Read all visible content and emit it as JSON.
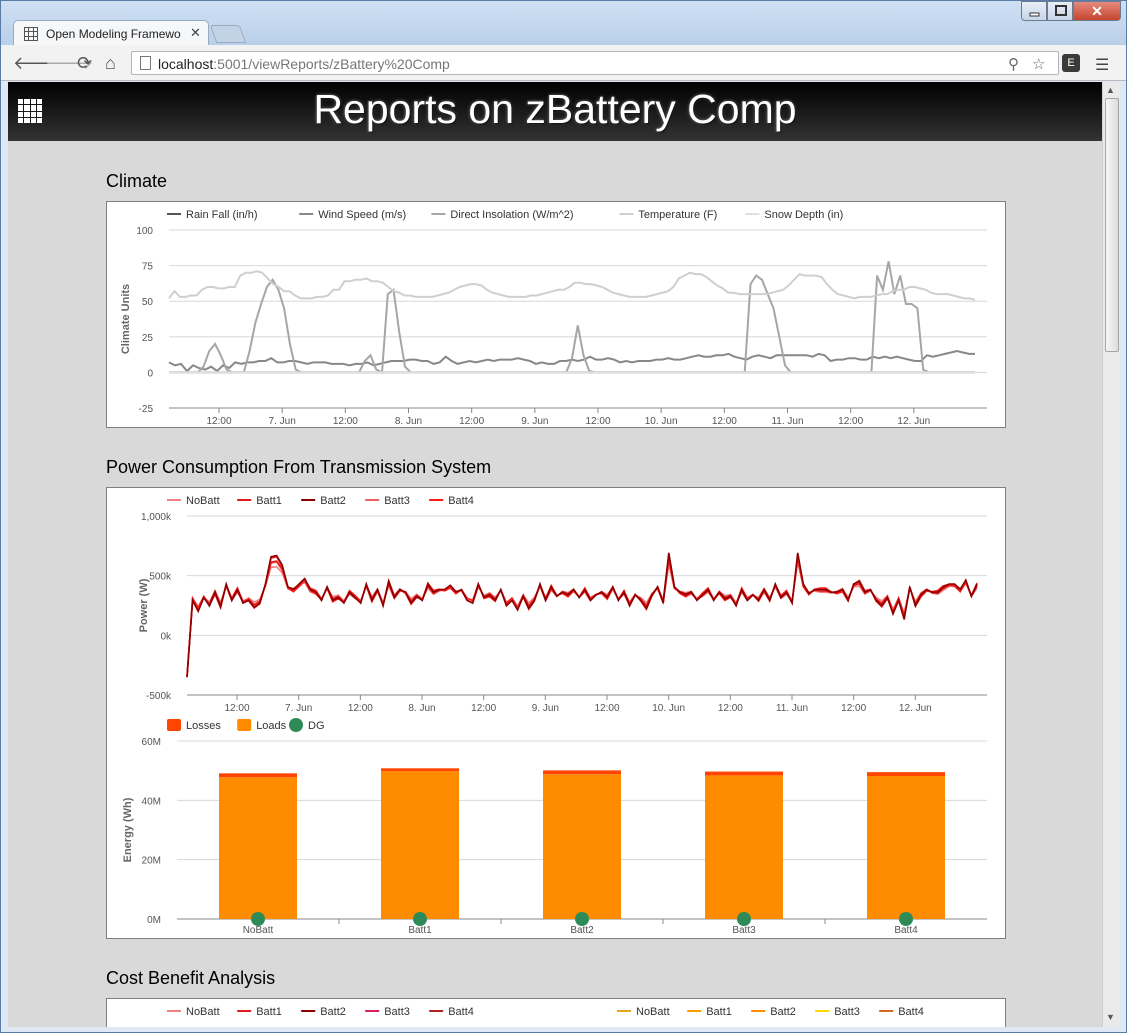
{
  "browser": {
    "tab_title": "Open Modeling Framework",
    "url_host": "localhost",
    "url_rest": ":5001/viewReports/zBattery%20Comp"
  },
  "page": {
    "title": "Reports on zBattery Comp"
  },
  "sections": {
    "climate": "Climate",
    "power": "Power Consumption From Transmission System",
    "cost": "Cost Benefit Analysis"
  },
  "colors": {
    "accent_orange": "#ff8c00",
    "loss_red": "#ff4500",
    "dg_green": "#2e8b57"
  },
  "chart_data": [
    {
      "id": "climate",
      "type": "line",
      "ylabel": "Climate Units",
      "ylim": [
        -25,
        100
      ],
      "yticks": [
        -25,
        0,
        25,
        50,
        75,
        100
      ],
      "xticks": [
        "12:00",
        "7. Jun",
        "12:00",
        "8. Jun",
        "12:00",
        "9. Jun",
        "12:00",
        "10. Jun",
        "12:00",
        "11. Jun",
        "12:00",
        "12. Jun"
      ],
      "grid": true,
      "legend": "top-left",
      "series": [
        {
          "name": "Rain Fall (in/h)",
          "color": "#555555",
          "values": [
            0,
            0,
            0,
            0,
            0,
            0,
            0,
            0,
            0,
            0,
            0,
            0,
            0,
            0,
            0,
            0,
            0,
            0,
            0,
            0,
            0,
            0,
            0,
            0,
            0,
            0,
            0,
            0,
            0,
            0,
            0,
            0,
            0,
            0,
            0,
            0,
            0,
            0,
            0,
            0,
            0,
            0,
            0,
            0,
            0,
            0,
            0,
            0,
            0,
            0,
            0,
            0,
            0,
            0,
            0,
            0,
            0,
            0,
            0,
            0,
            0,
            0,
            0,
            0,
            0,
            0,
            0,
            0,
            0,
            0,
            0,
            0,
            0,
            0,
            0,
            0,
            0,
            0,
            0,
            0,
            0,
            0,
            0,
            0,
            0,
            0,
            0,
            0,
            0,
            0,
            0,
            0,
            0,
            0,
            0,
            0,
            0,
            0,
            0,
            0,
            0,
            0,
            0,
            0,
            0,
            0,
            0,
            0,
            0,
            0,
            0,
            0,
            0,
            0,
            0,
            0,
            0,
            0,
            0,
            0,
            0,
            0,
            0,
            0,
            0
          ]
        },
        {
          "name": "Wind Speed (m/s)",
          "color": "#888888",
          "values": [
            7,
            5,
            6,
            1,
            5,
            3,
            2,
            4,
            1,
            5,
            3,
            7,
            6,
            7,
            7,
            8,
            8,
            10,
            7,
            7,
            8,
            8,
            7,
            6,
            7,
            7,
            7,
            6,
            6,
            6,
            5,
            6,
            6,
            7,
            5,
            6,
            7,
            8,
            8,
            8,
            9,
            9,
            8,
            8,
            6,
            7,
            11,
            8,
            6,
            7,
            8,
            7,
            8,
            9,
            8,
            9,
            9,
            9,
            10,
            9,
            8,
            6,
            7,
            6,
            6,
            8,
            8,
            9,
            8,
            9,
            11,
            9,
            9,
            10,
            9,
            7,
            8,
            7,
            8,
            8,
            8,
            9,
            9,
            10,
            9,
            9,
            10,
            11,
            12,
            11,
            11,
            12,
            12,
            13,
            11,
            10,
            9,
            11,
            12,
            11,
            10,
            12,
            12,
            12,
            12,
            12,
            12,
            11,
            13,
            12,
            8,
            9,
            9,
            10,
            10,
            9,
            9,
            11,
            10,
            11,
            10,
            11,
            10,
            9,
            8,
            8,
            12,
            11,
            12,
            13,
            14,
            15,
            14,
            13,
            13
          ]
        },
        {
          "name": "Direct Insolation (W/m^2)",
          "color": "#a6a6a6",
          "values": [
            0,
            0,
            0,
            0,
            0,
            0,
            4,
            15,
            20,
            12,
            2,
            0,
            0,
            0,
            15,
            35,
            48,
            60,
            65,
            58,
            45,
            20,
            2,
            0,
            0,
            0,
            0,
            0,
            0,
            0,
            0,
            0,
            0,
            0,
            8,
            12,
            2,
            0,
            55,
            58,
            28,
            4,
            0,
            0,
            0,
            0,
            0,
            0,
            0,
            0,
            0,
            0,
            0,
            0,
            0,
            0,
            0,
            0,
            0,
            0,
            0,
            0,
            0,
            0,
            0,
            0,
            0,
            0,
            0,
            0,
            10,
            33,
            12,
            1,
            0,
            0,
            0,
            0,
            0,
            0,
            0,
            0,
            0,
            0,
            0,
            0,
            0,
            0,
            0,
            0,
            0,
            0,
            0,
            0,
            0,
            0,
            0,
            0,
            0,
            0,
            0,
            62,
            68,
            65,
            55,
            45,
            25,
            5,
            0,
            0,
            0,
            0,
            0,
            0,
            0,
            0,
            0,
            0,
            0,
            0,
            0,
            0,
            0,
            68,
            58,
            78,
            55,
            68,
            48,
            48,
            45,
            2,
            0,
            0,
            0,
            0,
            0,
            0,
            0,
            0,
            0
          ]
        },
        {
          "name": "Temperature (F)",
          "color": "#cfcfcf",
          "values": [
            52,
            57,
            53,
            53,
            54,
            54,
            58,
            60,
            60,
            59,
            59,
            60,
            60,
            68,
            70,
            70,
            71,
            70,
            66,
            62,
            60,
            57,
            57,
            54,
            52,
            52,
            52,
            53,
            53,
            54,
            58,
            58,
            64,
            64,
            65,
            65,
            66,
            64,
            64,
            63,
            60,
            57,
            56,
            54,
            54,
            53,
            53,
            53,
            53,
            54,
            55,
            56,
            58,
            60,
            61,
            62,
            62,
            61,
            58,
            56,
            55,
            54,
            53,
            53,
            53,
            53,
            54,
            54,
            55,
            56,
            57,
            58,
            58,
            60,
            63,
            63,
            62,
            62,
            61,
            60,
            58,
            56,
            55,
            54,
            53,
            53,
            53,
            53,
            54,
            55,
            56,
            57,
            60,
            66,
            68,
            70,
            69,
            69,
            67,
            64,
            61,
            59,
            56,
            56,
            55,
            55,
            55,
            55,
            55,
            55,
            56,
            57,
            58,
            61,
            65,
            69,
            68,
            68,
            68,
            67,
            62,
            58,
            55,
            54,
            53,
            52,
            53,
            53,
            53,
            54,
            55,
            55,
            57,
            58,
            58,
            60,
            60,
            59,
            58,
            56,
            55,
            55,
            55,
            54,
            53,
            52,
            52,
            51
          ]
        },
        {
          "name": "Snow Depth (in)",
          "color": "#e0e0e0",
          "values": [
            0,
            0,
            0,
            0,
            0,
            0,
            0,
            0,
            0,
            0,
            0,
            0,
            0,
            0,
            0,
            0,
            0,
            0,
            0,
            0,
            0,
            0,
            0,
            0,
            0,
            0,
            0,
            0,
            0,
            0,
            0,
            0,
            0,
            0,
            0,
            0,
            0,
            0,
            0,
            0,
            0,
            0,
            0,
            0,
            0,
            0,
            0,
            0,
            0,
            0,
            0,
            0,
            0,
            0,
            0,
            0,
            0,
            0,
            0,
            0,
            0,
            0,
            0,
            0,
            0,
            0,
            0,
            0,
            0,
            0,
            0,
            0,
            0,
            0,
            0,
            0,
            0,
            0,
            0,
            0,
            0,
            0,
            0,
            0,
            0,
            0,
            0,
            0,
            0,
            0,
            0,
            0,
            0,
            0,
            0,
            0,
            0,
            0,
            0,
            0,
            0,
            0,
            0,
            0,
            0,
            0,
            0,
            0,
            0,
            0,
            0,
            0,
            0,
            0,
            0,
            0,
            0,
            0,
            0,
            0,
            0,
            0,
            0,
            0,
            0
          ]
        }
      ]
    },
    {
      "id": "power",
      "type": "line",
      "ylabel": "Power (W)",
      "ylim": [
        -500000,
        1000000
      ],
      "ytick_labels": [
        "-500k",
        "0k",
        "500k",
        "1,000k"
      ],
      "yticks": [
        -500000,
        0,
        500000,
        1000000
      ],
      "xticks": [
        "12:00",
        "7. Jun",
        "12:00",
        "8. Jun",
        "12:00",
        "9. Jun",
        "12:00",
        "10. Jun",
        "12:00",
        "11. Jun",
        "12:00",
        "12. Jun"
      ],
      "grid": true,
      "legend": "top-left",
      "series": [
        {
          "name": "NoBatt",
          "color": "#f28080"
        },
        {
          "name": "Batt1",
          "color": "#e31a1c"
        },
        {
          "name": "Batt2",
          "color": "#8b0000"
        },
        {
          "name": "Batt3",
          "color": "#f06060"
        },
        {
          "name": "Batt4",
          "color": "#ff1a1a"
        }
      ],
      "base_values": [
        -350000,
        300000,
        220000,
        320000,
        260000,
        360000,
        250000,
        420000,
        300000,
        380000,
        280000,
        300000,
        250000,
        280000,
        420000,
        620000,
        630000,
        560000,
        400000,
        380000,
        420000,
        460000,
        380000,
        360000,
        300000,
        400000,
        300000,
        320000,
        280000,
        360000,
        320000,
        280000,
        420000,
        300000,
        380000,
        260000,
        440000,
        320000,
        380000,
        360000,
        280000,
        330000,
        300000,
        420000,
        360000,
        380000,
        380000,
        410000,
        360000,
        380000,
        300000,
        280000,
        420000,
        320000,
        340000,
        300000,
        380000,
        260000,
        300000,
        230000,
        330000,
        240000,
        300000,
        420000,
        300000,
        400000,
        330000,
        360000,
        340000,
        380000,
        320000,
        380000,
        300000,
        340000,
        360000,
        320000,
        400000,
        300000,
        360000,
        260000,
        340000,
        300000,
        240000,
        340000,
        400000,
        280000,
        650000,
        400000,
        360000,
        340000,
        360000,
        300000,
        340000,
        380000,
        300000,
        360000,
        310000,
        330000,
        260000,
        380000,
        300000,
        340000,
        300000,
        380000,
        300000,
        420000,
        320000,
        360000,
        280000,
        650000,
        420000,
        350000,
        380000,
        380000,
        380000,
        360000,
        360000,
        380000,
        300000,
        420000,
        440000,
        360000,
        380000,
        300000,
        260000,
        320000,
        200000,
        300000,
        160000,
        400000,
        260000,
        340000,
        380000,
        360000,
        360000,
        400000,
        420000,
        420000,
        380000,
        450000,
        330000,
        420000
      ]
    },
    {
      "id": "energy",
      "type": "bar",
      "ylabel": "Energy (Wh)",
      "ylim": [
        0,
        60000000
      ],
      "ytick_labels": [
        "0M",
        "20M",
        "40M",
        "60M"
      ],
      "yticks": [
        0,
        20000000,
        40000000,
        60000000
      ],
      "categories": [
        "NoBatt",
        "Batt1",
        "Batt2",
        "Batt3",
        "Batt4"
      ],
      "legend": "top-left",
      "series": [
        {
          "name": "Losses",
          "color": "#ff4500",
          "values": [
            1300000,
            1000000,
            1300000,
            1300000,
            1300000
          ]
        },
        {
          "name": "Loads",
          "color": "#ff8c00",
          "values": [
            47800000,
            49800000,
            48800000,
            48400000,
            48200000
          ]
        },
        {
          "name": "DG",
          "color": "#2e8b57",
          "values": [
            0,
            0,
            0,
            0,
            0
          ]
        }
      ]
    },
    {
      "id": "cost-left",
      "type": "line",
      "legend": "top-left",
      "series": [
        {
          "name": "NoBatt",
          "color": "#f28080"
        },
        {
          "name": "Batt1",
          "color": "#e31a1c"
        },
        {
          "name": "Batt2",
          "color": "#8b0000"
        },
        {
          "name": "Batt3",
          "color": "#d62058"
        },
        {
          "name": "Batt4",
          "color": "#b22222"
        }
      ]
    },
    {
      "id": "cost-right",
      "type": "line",
      "legend": "top-left",
      "series": [
        {
          "name": "NoBatt",
          "color": "#e6a817"
        },
        {
          "name": "Batt1",
          "color": "#ff9900"
        },
        {
          "name": "Batt2",
          "color": "#ff8c00"
        },
        {
          "name": "Batt3",
          "color": "#ffd700"
        },
        {
          "name": "Batt4",
          "color": "#d2691e"
        }
      ]
    }
  ]
}
